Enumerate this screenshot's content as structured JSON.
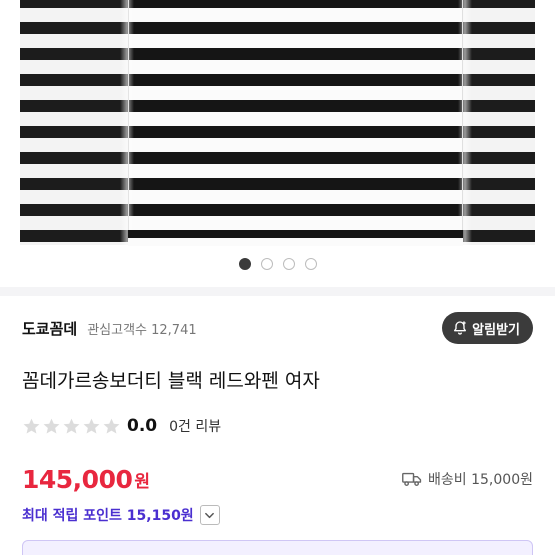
{
  "gallery": {
    "image_alt": "검정 흰색 스트라이프 긴팔 티셔츠",
    "dots": [
      true,
      false,
      false,
      false
    ]
  },
  "shop": {
    "name": "도쿄꼼데",
    "interest_label": "관심고객수 12,741",
    "alarm_label": "알림받기"
  },
  "product": {
    "title": "꼼데가르송보더티 블랙 레드와펜 여자"
  },
  "rating": {
    "value": "0.0",
    "review_count": "0건 리뷰",
    "stars_filled": 0,
    "stars_total": 5
  },
  "price": {
    "amount": "145,000",
    "unit": "원",
    "color": "#e8273f"
  },
  "shipping": {
    "label": "배송비 15,000원",
    "icon": "truck-icon"
  },
  "points": {
    "label": "최대 적립 포인트 15,150원",
    "color": "#4a2fd0"
  }
}
